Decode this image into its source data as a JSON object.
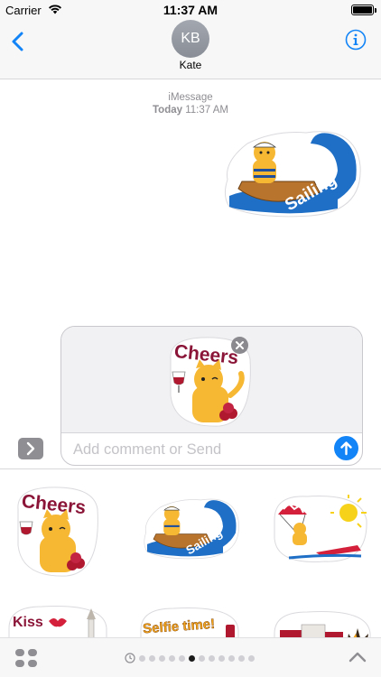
{
  "status_bar": {
    "carrier": "Carrier",
    "time": "11:37 AM",
    "battery_level": 1.0
  },
  "header": {
    "contact_initials": "KB",
    "contact_name": "Kate"
  },
  "thread": {
    "service": "iMessage",
    "day": "Today",
    "time": "11:37 AM",
    "sent_sticker": {
      "caption": "Sailing",
      "icon": "sailing-cat-sticker"
    }
  },
  "compose": {
    "attached_sticker": {
      "caption": "Cheers",
      "icon": "cheers-cat-sticker"
    },
    "placeholder": "Add comment or Send"
  },
  "drawer": {
    "stickers": [
      {
        "caption": "Cheers",
        "icon": "cheers-cat-sticker"
      },
      {
        "caption": "Sailing",
        "icon": "sailing-cat-sticker"
      },
      {
        "caption": "",
        "icon": "parasailing-cat-sticker"
      },
      {
        "caption": "Kiss",
        "icon": "kiss-cat-sticker"
      },
      {
        "caption": "Selfie time!",
        "icon": "selfie-cat-sticker"
      },
      {
        "caption": "",
        "icon": "village-cat-sticker"
      }
    ]
  },
  "bottom_bar": {
    "page_count": 12,
    "active_page": 5
  },
  "colors": {
    "accent": "#1284f7",
    "sticker_wave": "#1f6fc6",
    "cat_orange": "#f6b733",
    "cheers_text": "#8a1538",
    "selfie_text": "#f2a41c"
  }
}
